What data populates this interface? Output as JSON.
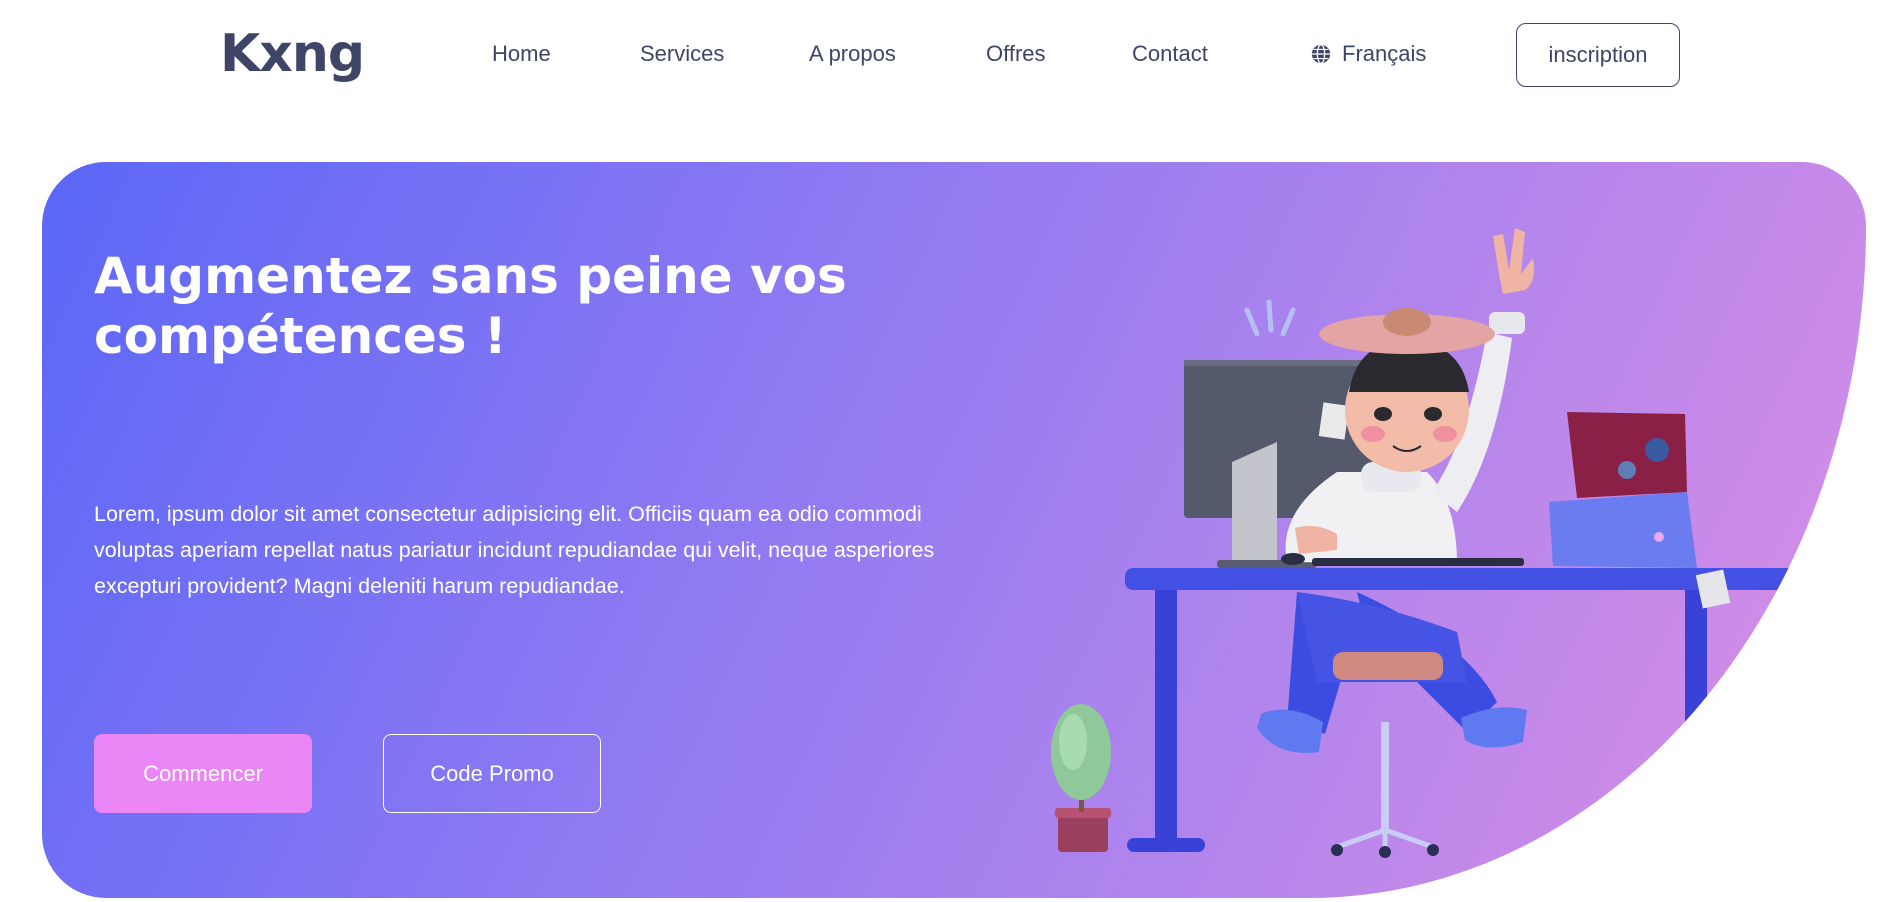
{
  "header": {
    "logo": "Kxng",
    "nav": [
      {
        "label": "Home"
      },
      {
        "label": "Services"
      },
      {
        "label": "A propos"
      },
      {
        "label": "Offres"
      },
      {
        "label": "Contact"
      }
    ],
    "language": {
      "label": "Français",
      "icon": "globe-icon"
    },
    "signup_label": "inscription"
  },
  "hero": {
    "title": "Augmentez sans peine vos compétences !",
    "description": "Lorem, ipsum dolor sit amet consectetur adipisicing elit. Officiis quam ea odio commodi voluptas aperiam repellat natus pariatur incidunt repudiandae qui velit, neque asperiores excepturi provident? Magni deleniti harum repudiandae.",
    "primary_button": "Commencer",
    "secondary_button": "Code Promo",
    "illustration": "person-at-desk-illustration"
  },
  "colors": {
    "text_dark": "#3f4566",
    "gradient_start": "#5b67f7",
    "gradient_end": "#dc8fe6",
    "primary_button": "#ea86f6"
  }
}
